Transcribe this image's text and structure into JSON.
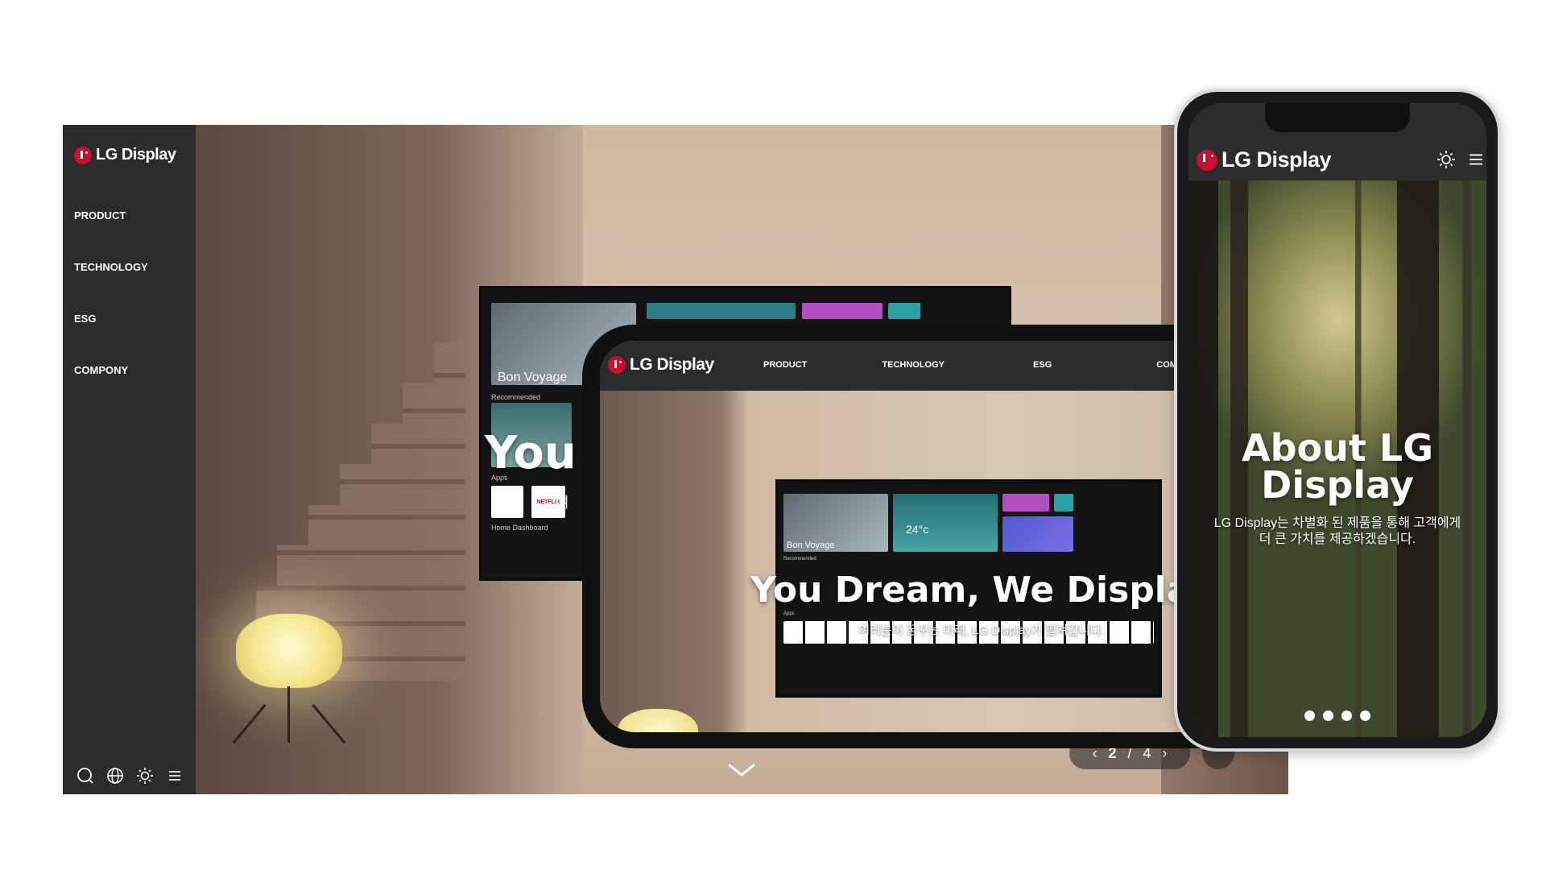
{
  "brand": {
    "name": "LG Display",
    "accent": "#c8102e"
  },
  "desktop": {
    "nav": [
      "PRODUCT",
      "TECHNOLOGY",
      "ESG",
      "COMPONY"
    ],
    "icons": [
      "search-icon",
      "globe-icon",
      "sun-icon",
      "menu-icon"
    ],
    "tv_labels": {
      "bon_voyage": "Bon Voyage",
      "recommended": "Recommended",
      "apps": "Apps",
      "home_dashboard": "Home Dashboard",
      "netflix": "NETFLIX"
    },
    "hero_partial": "You I",
    "hero_sub_partial": "여",
    "pager": {
      "current": "2",
      "separator": "/",
      "total": "4"
    }
  },
  "tablet": {
    "nav": [
      "PRODUCT",
      "TECHNOLOGY",
      "ESG",
      "COM"
    ],
    "hero_title": "You Dream, We Display",
    "hero_sub": "여러분이 꿈꾸는 미래, LG Display가 펼쳐갑니다.",
    "tv_labels": {
      "bon_voyage": "Bon Voyage",
      "recommended": "Recommended",
      "apps": "Apps",
      "temp": "24°c"
    }
  },
  "phone": {
    "hero_title": "About LG Display",
    "hero_sub": "LG Display는 차별화 된 제품을 통해 고객에게 더 큰 가치를 제공하겠습니다.",
    "slides": 4
  }
}
